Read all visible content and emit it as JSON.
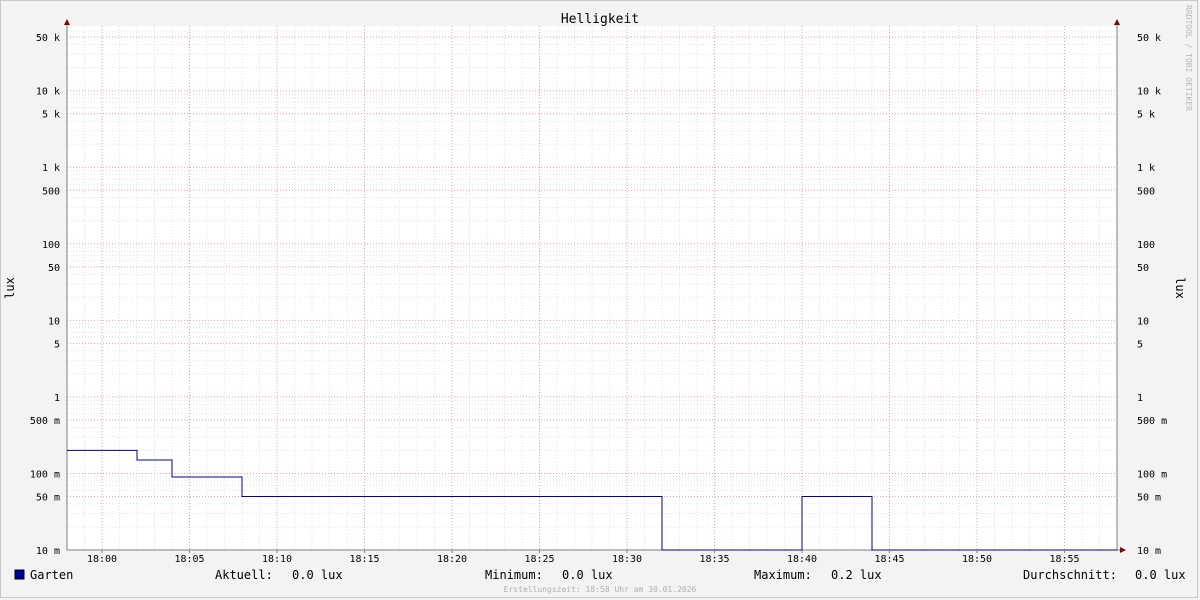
{
  "chart_data": {
    "type": "line",
    "title": "Helligkeit",
    "ylabel": "lux",
    "yscale": "log",
    "ylim": [
      0.01,
      70000
    ],
    "xlim": [
      "17:58",
      "18:58"
    ],
    "grid": true,
    "x_ticks": [
      "18:00",
      "18:05",
      "18:10",
      "18:15",
      "18:20",
      "18:25",
      "18:30",
      "18:35",
      "18:40",
      "18:45",
      "18:50",
      "18:55"
    ],
    "y_ticks": [
      {
        "value": 50000,
        "label": "50 k"
      },
      {
        "value": 10000,
        "label": "10 k"
      },
      {
        "value": 5000,
        "label": "5 k"
      },
      {
        "value": 1000,
        "label": "1 k"
      },
      {
        "value": 500,
        "label": "500"
      },
      {
        "value": 100,
        "label": "100"
      },
      {
        "value": 50,
        "label": "50"
      },
      {
        "value": 10,
        "label": "10"
      },
      {
        "value": 5,
        "label": "5"
      },
      {
        "value": 1,
        "label": "1"
      },
      {
        "value": 0.5,
        "label": "500 m"
      },
      {
        "value": 0.1,
        "label": "100 m"
      },
      {
        "value": 0.05,
        "label": "50 m"
      },
      {
        "value": 0.01,
        "label": "10 m"
      }
    ],
    "series": [
      {
        "name": "Garten",
        "color": "#000099",
        "step": true,
        "points": [
          {
            "x": "17:58",
            "y": 0.2
          },
          {
            "x": "18:02",
            "y": 0.15
          },
          {
            "x": "18:04",
            "y": 0.09
          },
          {
            "x": "18:08",
            "y": 0.05
          },
          {
            "x": "18:10",
            "y": 0.05
          },
          {
            "x": "18:32",
            "y": 0.01
          },
          {
            "x": "18:40",
            "y": 0.05
          },
          {
            "x": "18:44",
            "y": 0.01
          },
          {
            "x": "18:58",
            "y": 0.01
          }
        ]
      }
    ]
  },
  "credit": "RRDTOOL / TOBI OETIKER",
  "legend": {
    "series_name": "Garten",
    "current_label": "Aktuell:",
    "current_value": "0.0 lux",
    "min_label": "Minimum:",
    "min_value": "0.0 lux",
    "max_label": "Maximum:",
    "max_value": "0.2 lux",
    "avg_label": "Durchschnitt:",
    "avg_value": "0.0 lux"
  },
  "footer": "Erstellungszeit: 18:58 Uhr am 30.01.2026"
}
